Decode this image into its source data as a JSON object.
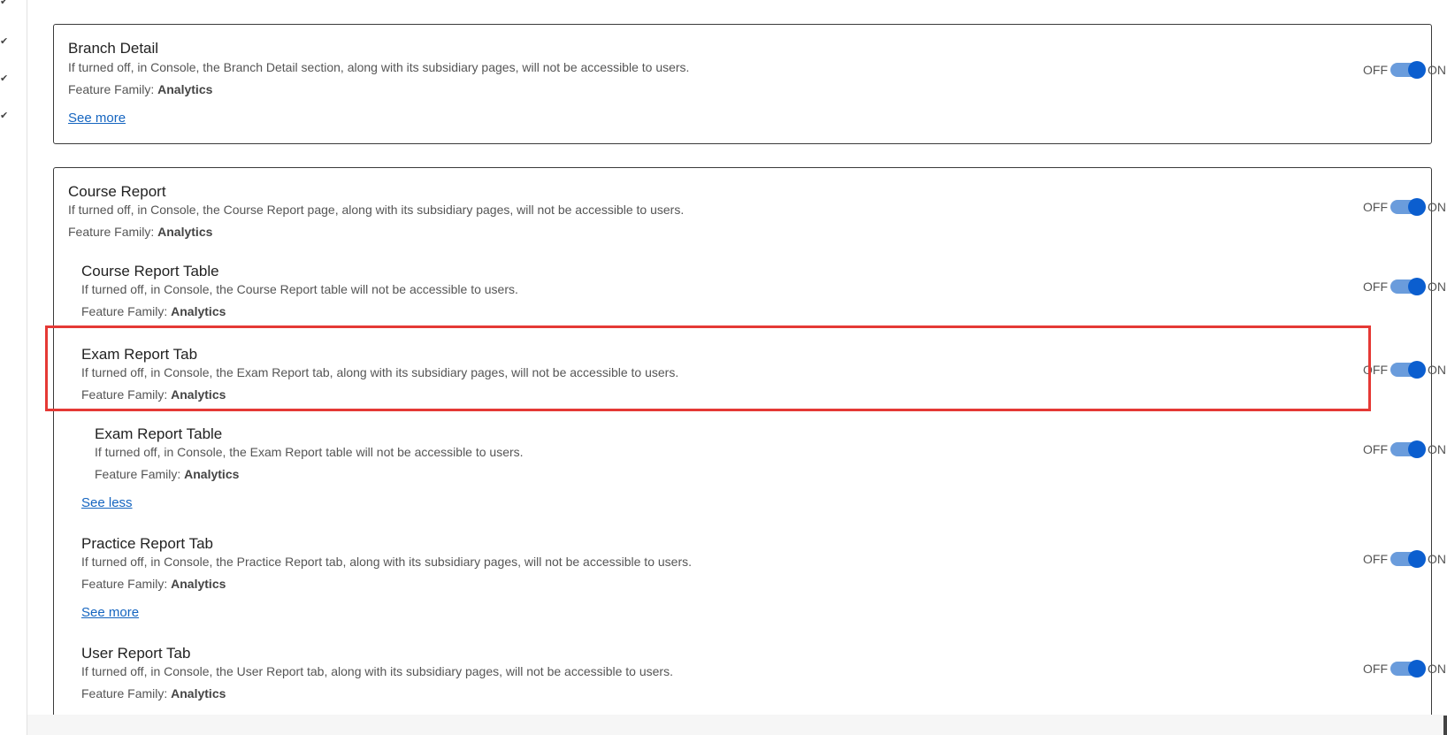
{
  "toggle": {
    "off_label": "OFF",
    "on_label": "ON",
    "accent": "#0b5ecf",
    "track": "#6a9cdc"
  },
  "family_prefix": "Feature Family:",
  "highlight_color": "#e53935",
  "features": {
    "branch_detail": {
      "title": "Branch Detail",
      "desc": "If turned off, in Console, the Branch Detail section, along with its subsidiary pages, will not be accessible to users.",
      "family": "Analytics",
      "link": "See more",
      "state": "on"
    },
    "course_report": {
      "title": "Course Report",
      "desc": "If turned off, in Console, the Course Report page, along with its subsidiary pages, will not be accessible to users.",
      "family": "Analytics",
      "state": "on"
    },
    "course_report_table": {
      "title": "Course Report Table",
      "desc": "If turned off, in Console, the Course Report table will not be accessible to users.",
      "family": "Analytics",
      "state": "on"
    },
    "exam_report_tab": {
      "title": "Exam Report Tab",
      "desc": "If turned off, in Console, the Exam Report tab, along with its subsidiary pages, will not be accessible to users.",
      "family": "Analytics",
      "state": "on",
      "highlighted": true
    },
    "exam_report_table": {
      "title": "Exam Report Table",
      "desc": "If turned off, in Console, the Exam Report table will not be accessible to users.",
      "family": "Analytics",
      "state": "on",
      "link": "See less"
    },
    "practice_report_tab": {
      "title": "Practice Report Tab",
      "desc": "If turned off, in Console, the Practice Report tab, along with its subsidiary pages, will not be accessible to users.",
      "family": "Analytics",
      "state": "on",
      "link": "See more"
    },
    "user_report_tab": {
      "title": "User Report Tab",
      "desc": "If turned off, in Console, the User Report tab, along with its subsidiary pages, will not be accessible to users.",
      "family": "Analytics",
      "state": "on"
    }
  }
}
